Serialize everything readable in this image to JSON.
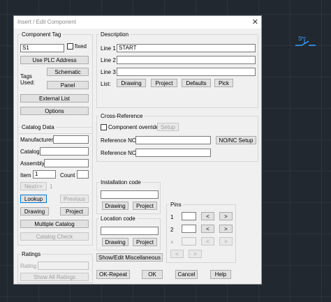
{
  "dialog": {
    "title": "Insert / Edit Component",
    "close": "✕"
  },
  "component_tag": {
    "label": "Component Tag",
    "value": "S1",
    "fixed_label": "fixed",
    "use_plc_address": "Use PLC Address",
    "tags_used": "Tags Used:",
    "schematic": "Schematic",
    "panel": "Panel",
    "external_list": "External List",
    "options": "Options"
  },
  "description": {
    "label": "Description",
    "line1_label": "Line 1",
    "line1_value": "START",
    "line2_label": "Line 2",
    "line2_value": "",
    "line3_label": "Line 3",
    "line3_value": "",
    "list_label": "List:",
    "drawing": "Drawing",
    "project": "Project",
    "defaults": "Defaults",
    "pick": "Pick"
  },
  "cross_reference": {
    "label": "Cross-Reference",
    "component_override": "Component override",
    "setup": "Setup",
    "ref_no_label": "Reference NO",
    "ref_nc_label": "Reference NC",
    "nonc_setup": "NO/NC Setup"
  },
  "catalog": {
    "label": "Catalog Data",
    "manufacturer": "Manufacturer",
    "catalog": "Catalog",
    "assembly": "Assembly",
    "item": "Item",
    "item_value": "1",
    "count": "Count",
    "next": "Next>>",
    "next_value": "1",
    "lookup": "Lookup",
    "previous": "Previous",
    "drawing": "Drawing",
    "project": "Project",
    "multiple_catalog": "Multiple Catalog",
    "catalog_check": "Catalog Check"
  },
  "installation": {
    "label": "Installation code",
    "drawing": "Drawing",
    "project": "Project"
  },
  "location": {
    "label": "Location code",
    "drawing": "Drawing",
    "project": "Project"
  },
  "show_misc": "Show/Edit Miscellaneous",
  "pins": {
    "label": "Pins",
    "row1": "1",
    "row2": "2",
    "row3": "×",
    "prev": "<",
    "next": ">"
  },
  "ratings": {
    "label": "Ratings",
    "rating": "Rating",
    "show_all": "Show All Ratings"
  },
  "footer": {
    "ok_repeat": "OK-Repeat",
    "ok": "OK",
    "cancel": "Cancel",
    "help": "Help"
  },
  "colors": {
    "accent": "#0078d7",
    "canvas": "#212830",
    "symbol": "#3aa0ff"
  }
}
